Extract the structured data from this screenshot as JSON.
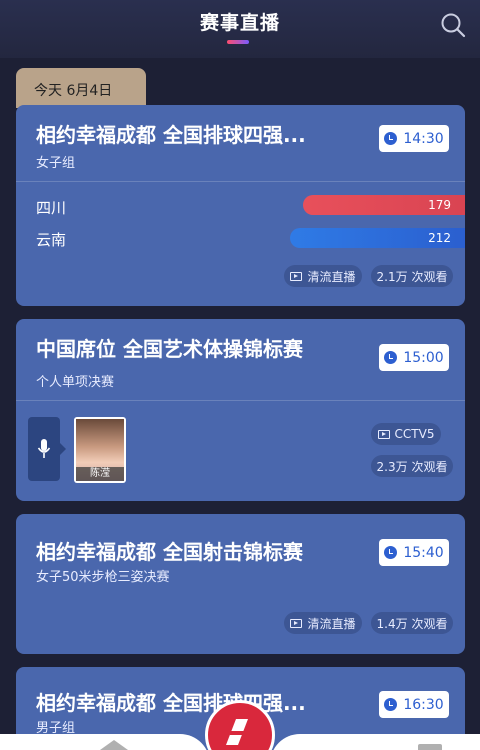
{
  "header": {
    "title": "赛事直播"
  },
  "date_tab": {
    "label": "今天 6月4日"
  },
  "cards": [
    {
      "title": "相约幸福成都 全国排球四强...",
      "subtitle": "女子组",
      "time": "14:30",
      "teams": [
        {
          "name": "四川",
          "votes": "179",
          "color": "#e8505b"
        },
        {
          "name": "云南",
          "votes": "212",
          "color": "#2f7be6"
        }
      ],
      "stream_label": "清流直播",
      "views": "2.1万 次观看"
    },
    {
      "title": "中国席位 全国艺术体操锦标赛",
      "subtitle": "个人单项决赛",
      "time": "15:00",
      "commentator": "陈滢",
      "channel": "CCTV5",
      "views": "2.3万 次观看"
    },
    {
      "title": "相约幸福成都 全国射击锦标赛",
      "subtitle": "女子50米步枪三姿决赛",
      "time": "15:40",
      "stream_label": "清流直播",
      "views": "1.4万 次观看"
    },
    {
      "title": "相约幸福成都 全国排球四强...",
      "subtitle": "男子组",
      "time": "16:30"
    }
  ],
  "icons": {
    "search": "search-icon",
    "clock": "clock-icon",
    "tv": "tv-icon",
    "mic": "microphone-icon",
    "home": "home-icon",
    "doc": "document-icon",
    "logo": "app-logo-icon"
  },
  "colors": {
    "card_bg": "#4a67ad",
    "page_bg": "#1d2035",
    "accent_red": "#d9283c",
    "time_text": "#2d5fd0"
  }
}
